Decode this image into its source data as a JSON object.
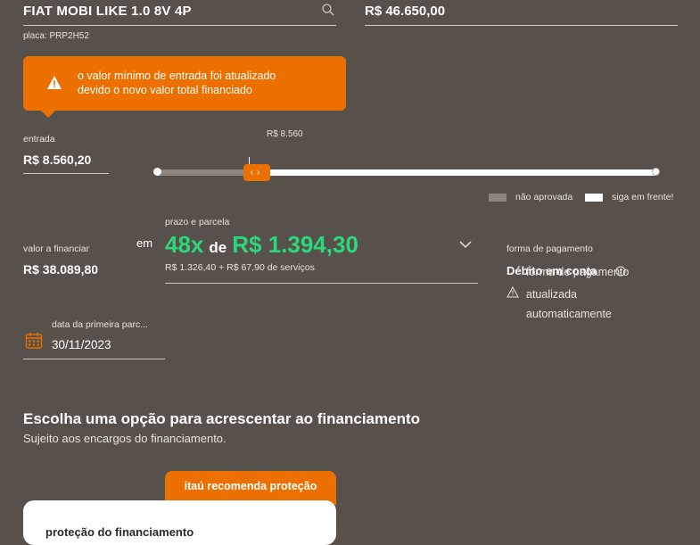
{
  "header": {
    "vehicle": "FIAT MOBI LIKE 1.0 8V 4P",
    "vehicle_price": "R$ 46.650,00",
    "plate": "placa: PRP2H52"
  },
  "alert": {
    "line1": "o valor mínimo de entrada foi atualizado",
    "line2": "devido o novo valor total financiado"
  },
  "entrada": {
    "label": "entrada",
    "value": "R$ 8.560,20",
    "slider_min_label": "R$ 8.560",
    "slider_position_fraction": 0.2
  },
  "legend": {
    "not_approved": "não aprovada",
    "go_ahead": "siga em frente!"
  },
  "financiar": {
    "label": "valor a financiar",
    "value": "R$ 38.089,80",
    "em": "em"
  },
  "prazo": {
    "label": "prazo e parcela",
    "installments": "48x",
    "de": "de",
    "installment_value": "R$ 1.394,30",
    "detail": "R$ 1.326,40 + R$ 67,90 de serviços"
  },
  "forma_pagamento": {
    "label": "forma de pagamento",
    "value": "Débito em conta",
    "overlay": "forma de pagamento",
    "warning_line1": "atualizada",
    "warning_line2": "automaticamente"
  },
  "primeira_parcela": {
    "label": "data da primeira parc...",
    "value": "30/11/2023"
  },
  "section": {
    "title": "Escolha uma opção para acrescentar ao financiamento",
    "subtitle": "Sujeito aos encargos do financiamento.",
    "recommend_label": "itaú recomenda proteção",
    "card_title": "proteção do financiamento"
  },
  "colors": {
    "background": "#57504b",
    "accent": "#ec7000",
    "highlight_green": "#2bd97c"
  }
}
